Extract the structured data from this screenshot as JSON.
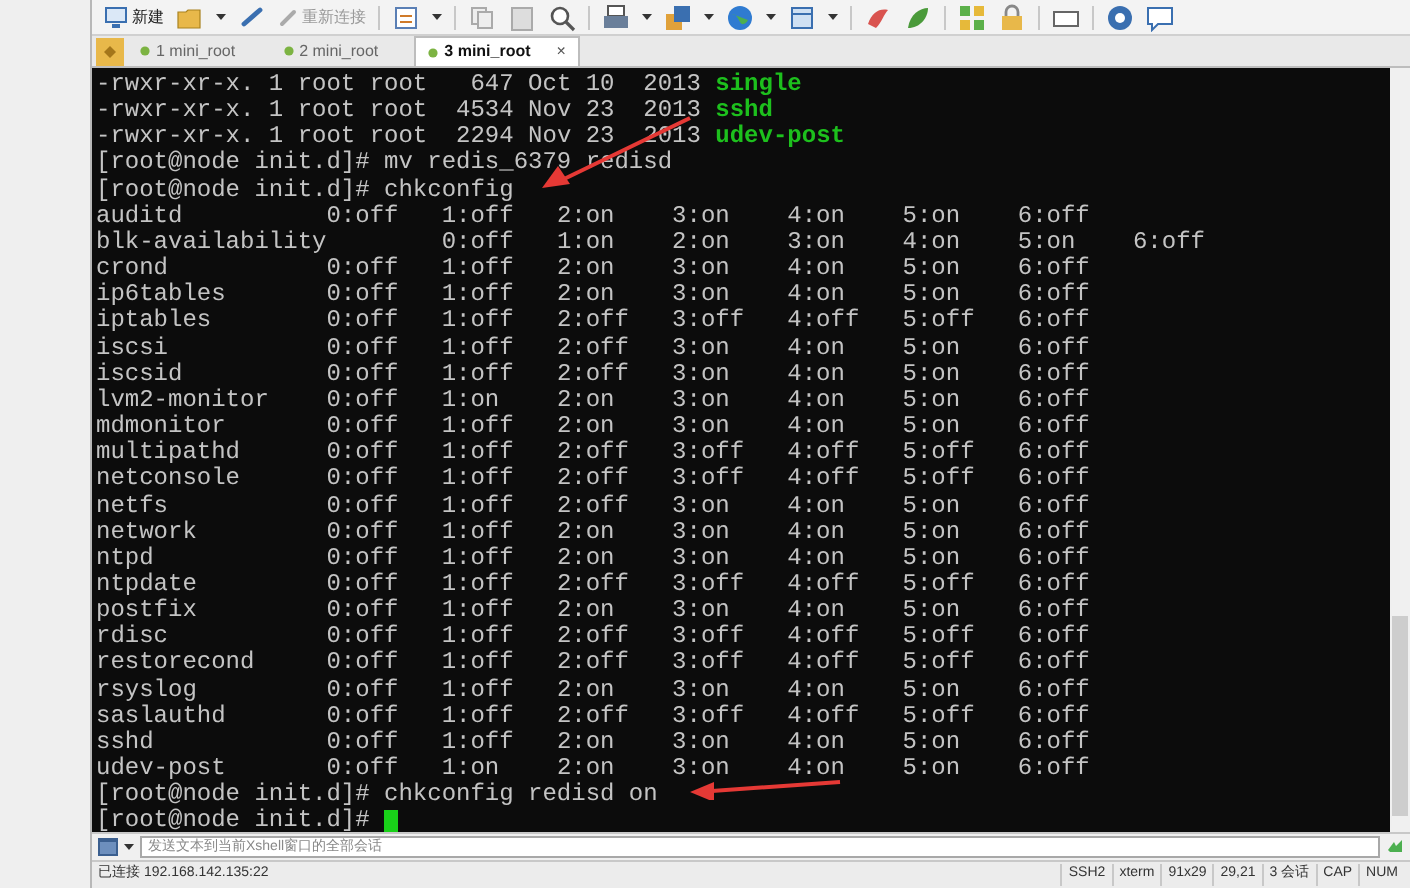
{
  "toolbar": {
    "new_button": "新建",
    "reconnect_button": {
      "label": "重新连接",
      "disabled": true
    }
  },
  "tabs": [
    {
      "label": "1 mini_root",
      "selected": false
    },
    {
      "label": "2 mini_root",
      "selected": false
    },
    {
      "label": "3 mini_root",
      "selected": true,
      "close": "×"
    }
  ],
  "terminal": {
    "lines": [
      {
        "kind": "ls",
        "text": "-rwxr-xr-x. 1 root root   647 Oct 10  2013 ",
        "name": "single"
      },
      {
        "kind": "ls",
        "text": "-rwxr-xr-x. 1 root root  4534 Nov 23  2013 ",
        "name": "sshd"
      },
      {
        "kind": "ls",
        "text": "-rwxr-xr-x. 1 root root  2294 Nov 23  2013 ",
        "name": "udev-post"
      },
      {
        "kind": "prompt",
        "prompt": "[root@node init.d]#",
        "command": "mv redis_6379 redisd"
      },
      {
        "kind": "prompt",
        "prompt": "[root@node init.d]#",
        "command": "chkconfig"
      },
      {
        "kind": "service",
        "service": "auditd",
        "levels": [
          "0:off",
          "1:off",
          "2:on",
          "3:on",
          "4:on",
          "5:on",
          "6:off"
        ]
      },
      {
        "kind": "service",
        "service": "blk-availability",
        "levels": [
          "0:off",
          "1:on",
          "2:on",
          "3:on",
          "4:on",
          "5:on",
          "6:off"
        ]
      },
      {
        "kind": "service",
        "service": "crond",
        "levels": [
          "0:off",
          "1:off",
          "2:on",
          "3:on",
          "4:on",
          "5:on",
          "6:off"
        ]
      },
      {
        "kind": "service",
        "service": "ip6tables",
        "levels": [
          "0:off",
          "1:off",
          "2:on",
          "3:on",
          "4:on",
          "5:on",
          "6:off"
        ]
      },
      {
        "kind": "service",
        "service": "iptables",
        "levels": [
          "0:off",
          "1:off",
          "2:off",
          "3:off",
          "4:off",
          "5:off",
          "6:off"
        ]
      },
      {
        "kind": "service",
        "service": "iscsi",
        "levels": [
          "0:off",
          "1:off",
          "2:off",
          "3:on",
          "4:on",
          "5:on",
          "6:off"
        ]
      },
      {
        "kind": "service",
        "service": "iscsid",
        "levels": [
          "0:off",
          "1:off",
          "2:off",
          "3:on",
          "4:on",
          "5:on",
          "6:off"
        ]
      },
      {
        "kind": "service",
        "service": "lvm2-monitor",
        "levels": [
          "0:off",
          "1:on",
          "2:on",
          "3:on",
          "4:on",
          "5:on",
          "6:off"
        ]
      },
      {
        "kind": "service",
        "service": "mdmonitor",
        "levels": [
          "0:off",
          "1:off",
          "2:on",
          "3:on",
          "4:on",
          "5:on",
          "6:off"
        ]
      },
      {
        "kind": "service",
        "service": "multipathd",
        "levels": [
          "0:off",
          "1:off",
          "2:off",
          "3:off",
          "4:off",
          "5:off",
          "6:off"
        ]
      },
      {
        "kind": "service",
        "service": "netconsole",
        "levels": [
          "0:off",
          "1:off",
          "2:off",
          "3:off",
          "4:off",
          "5:off",
          "6:off"
        ]
      },
      {
        "kind": "service",
        "service": "netfs",
        "levels": [
          "0:off",
          "1:off",
          "2:off",
          "3:on",
          "4:on",
          "5:on",
          "6:off"
        ]
      },
      {
        "kind": "service",
        "service": "network",
        "levels": [
          "0:off",
          "1:off",
          "2:on",
          "3:on",
          "4:on",
          "5:on",
          "6:off"
        ]
      },
      {
        "kind": "service",
        "service": "ntpd",
        "levels": [
          "0:off",
          "1:off",
          "2:on",
          "3:on",
          "4:on",
          "5:on",
          "6:off"
        ]
      },
      {
        "kind": "service",
        "service": "ntpdate",
        "levels": [
          "0:off",
          "1:off",
          "2:off",
          "3:off",
          "4:off",
          "5:off",
          "6:off"
        ]
      },
      {
        "kind": "service",
        "service": "postfix",
        "levels": [
          "0:off",
          "1:off",
          "2:on",
          "3:on",
          "4:on",
          "5:on",
          "6:off"
        ]
      },
      {
        "kind": "service",
        "service": "rdisc",
        "levels": [
          "0:off",
          "1:off",
          "2:off",
          "3:off",
          "4:off",
          "5:off",
          "6:off"
        ]
      },
      {
        "kind": "service",
        "service": "restorecond",
        "levels": [
          "0:off",
          "1:off",
          "2:off",
          "3:off",
          "4:off",
          "5:off",
          "6:off"
        ]
      },
      {
        "kind": "service",
        "service": "rsyslog",
        "levels": [
          "0:off",
          "1:off",
          "2:on",
          "3:on",
          "4:on",
          "5:on",
          "6:off"
        ]
      },
      {
        "kind": "service",
        "service": "saslauthd",
        "levels": [
          "0:off",
          "1:off",
          "2:off",
          "3:off",
          "4:off",
          "5:off",
          "6:off"
        ]
      },
      {
        "kind": "service",
        "service": "sshd",
        "levels": [
          "0:off",
          "1:off",
          "2:on",
          "3:on",
          "4:on",
          "5:on",
          "6:off"
        ]
      },
      {
        "kind": "service",
        "service": "udev-post",
        "levels": [
          "0:off",
          "1:on",
          "2:on",
          "3:on",
          "4:on",
          "5:on",
          "6:off"
        ]
      },
      {
        "kind": "prompt",
        "prompt": "[root@node init.d]#",
        "command": "chkconfig redisd on"
      },
      {
        "kind": "prompt",
        "prompt": "[root@node init.d]#",
        "cursor": true
      }
    ]
  },
  "send_bar": {
    "placeholder": "发送文本到当前Xshell窗口的全部会话"
  },
  "status_bar": {
    "connection": "已连接 192.168.142.135:22",
    "items": [
      "SSH2",
      "xterm",
      "91x29",
      "29,21",
      "3 会话",
      "CAP",
      "NUM"
    ]
  }
}
